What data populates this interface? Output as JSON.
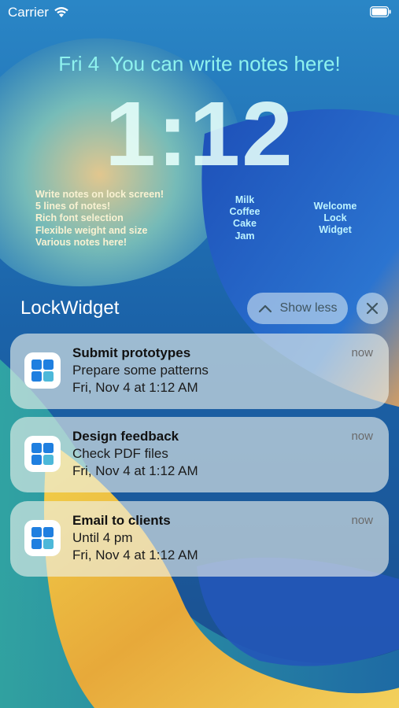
{
  "status_bar": {
    "carrier": "Carrier",
    "wifi_icon": "wifi-icon",
    "battery_icon": "battery-icon"
  },
  "lock_screen": {
    "date": "Fri 4",
    "top_note": "You can write notes here!",
    "time": "1:12"
  },
  "widgets": {
    "notes_lines": [
      "Write notes on lock screen!",
      "5 lines of notes!",
      "Rich font selection",
      "Flexible weight and size",
      "Various notes here!"
    ],
    "center_lines": [
      "Milk",
      "Coffee",
      "Cake",
      "Jam"
    ],
    "right_lines": [
      "Welcome",
      "Lock",
      "Widget"
    ]
  },
  "notification_group": {
    "app_name": "LockWidget",
    "show_less_label": "Show less",
    "show_less_icon": "chevron-up-icon",
    "close_icon": "close-icon"
  },
  "notifications": [
    {
      "title": "Submit prototypes",
      "body": "Prepare some patterns",
      "date": "Fri, Nov 4 at 1:12 AM",
      "time": "now",
      "icon": "app-grid-icon"
    },
    {
      "title": "Design feedback",
      "body": "Check PDF files",
      "date": "Fri, Nov 4 at 1:12 AM",
      "time": "now",
      "icon": "app-grid-icon"
    },
    {
      "title": "Email to clients",
      "body": "Until 4 pm",
      "date": "Fri, Nov 4 at 1:12 AM",
      "time": "now",
      "icon": "app-grid-icon"
    }
  ],
  "colors": {
    "accent": "#8ef2ee",
    "notes_text": "#f9f2d2",
    "widget_text": "#bdf3ff",
    "app_icon_blue": "#1f7fe0",
    "app_icon_light": "#4cb8d9"
  }
}
